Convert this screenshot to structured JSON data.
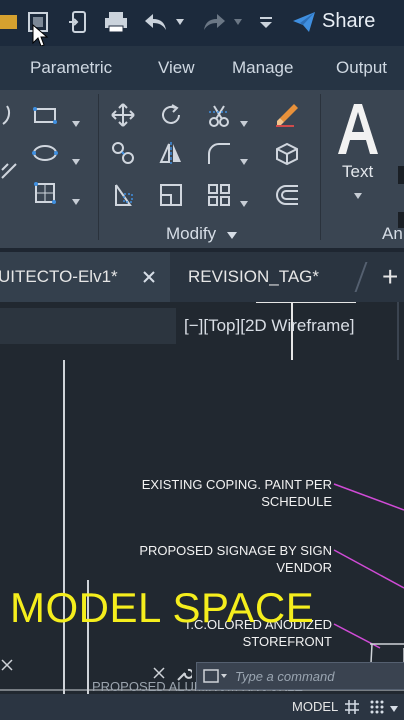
{
  "quick_access": {
    "icons": [
      "save-as-icon",
      "open-icon",
      "phone-icon",
      "print-icon",
      "undo-icon",
      "redo-icon",
      "customize-icon"
    ],
    "share_label": "Share"
  },
  "ribbon_tabs": [
    "Parametric",
    "View",
    "Manage",
    "Output"
  ],
  "modify_panel_label": "Modify",
  "annotation_panel_label": "An",
  "text_tool_label": "Text",
  "doc_tabs": {
    "active": "UITECTO-Elv1*",
    "second": "REVISION_TAG*",
    "add_label": "+"
  },
  "viewport_controls": "[−][Top][2D Wireframe]",
  "drawing_notes": [
    "EXISTING COPING. PAINT PER\nSCHEDULE",
    "PROPOSED SIGNAGE BY SIGN\nVENDOR",
    "T.C.OLORED ANODIZED\nSTOREFRONT",
    "PROPOSED ALUMINUM KNUCKLE CANOPY"
  ],
  "overlay_caption": "MODEL SPACE",
  "command_placeholder": "Type a command",
  "status_bar": {
    "model_label": "MODEL"
  },
  "colors": {
    "caption": "#f5ee1d",
    "leader": "#d04bd6",
    "share": "#3f8fe0"
  }
}
